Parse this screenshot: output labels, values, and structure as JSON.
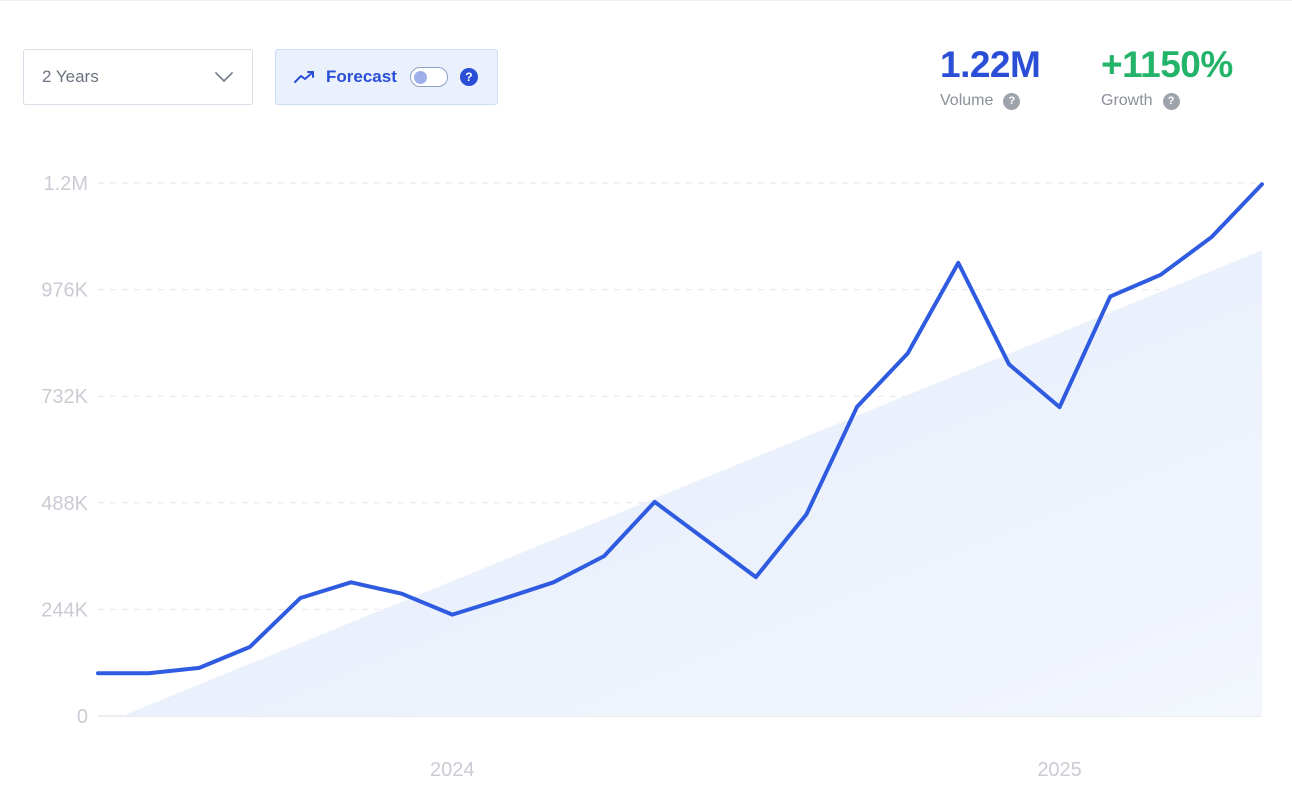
{
  "controls": {
    "range_label": "2 Years",
    "forecast_label": "Forecast",
    "forecast_enabled": false,
    "help_glyph": "?"
  },
  "stats": {
    "volume_value": "1.22M",
    "volume_label": "Volume",
    "growth_value": "+1150%",
    "growth_label": "Growth"
  },
  "colors": {
    "line": "#2f5be0",
    "volume": "#2a4fd6",
    "growth": "#23b46a",
    "trend_fill": "#e8effc"
  },
  "icons": {
    "range_chevron": "chevron-down-icon",
    "forecast": "trending-up-icon",
    "help": "question-circle-icon"
  },
  "chart_data": {
    "type": "area",
    "title": "",
    "xlabel": "",
    "ylabel": "",
    "ylim": [
      0,
      1220000
    ],
    "grid": true,
    "yticks": [
      {
        "value": 0,
        "label": "0"
      },
      {
        "value": 244000,
        "label": "244K"
      },
      {
        "value": 488000,
        "label": "488K"
      },
      {
        "value": 732000,
        "label": "732K"
      },
      {
        "value": 976000,
        "label": "976K"
      },
      {
        "value": 1220000,
        "label": "1.2M"
      }
    ],
    "xticks": [
      {
        "value": "2024-01",
        "label": "2024"
      },
      {
        "value": "2025-01",
        "label": "2025"
      }
    ],
    "series": [
      {
        "type": "line",
        "x": [
          "2023-06",
          "2023-07",
          "2023-08",
          "2023-09",
          "2023-10",
          "2023-11",
          "2023-12",
          "2024-01",
          "2024-02",
          "2024-03",
          "2024-04",
          "2024-05",
          "2024-06",
          "2024-07",
          "2024-08",
          "2024-09",
          "2024-10",
          "2024-11",
          "2024-12",
          "2025-01",
          "2025-02",
          "2025-03",
          "2025-04",
          "2025-05"
        ],
        "values": [
          98000,
          98000,
          110000,
          158000,
          270000,
          306000,
          280000,
          232000,
          268000,
          306000,
          366000,
          490000,
          404000,
          318000,
          462000,
          708000,
          830000,
          1037000,
          805000,
          707000,
          960000,
          1010000,
          1096000,
          1217000
        ]
      },
      {
        "type": "trend",
        "x": [
          "2023-06",
          "2025-05"
        ],
        "values": [
          0,
          1066000
        ]
      }
    ]
  }
}
